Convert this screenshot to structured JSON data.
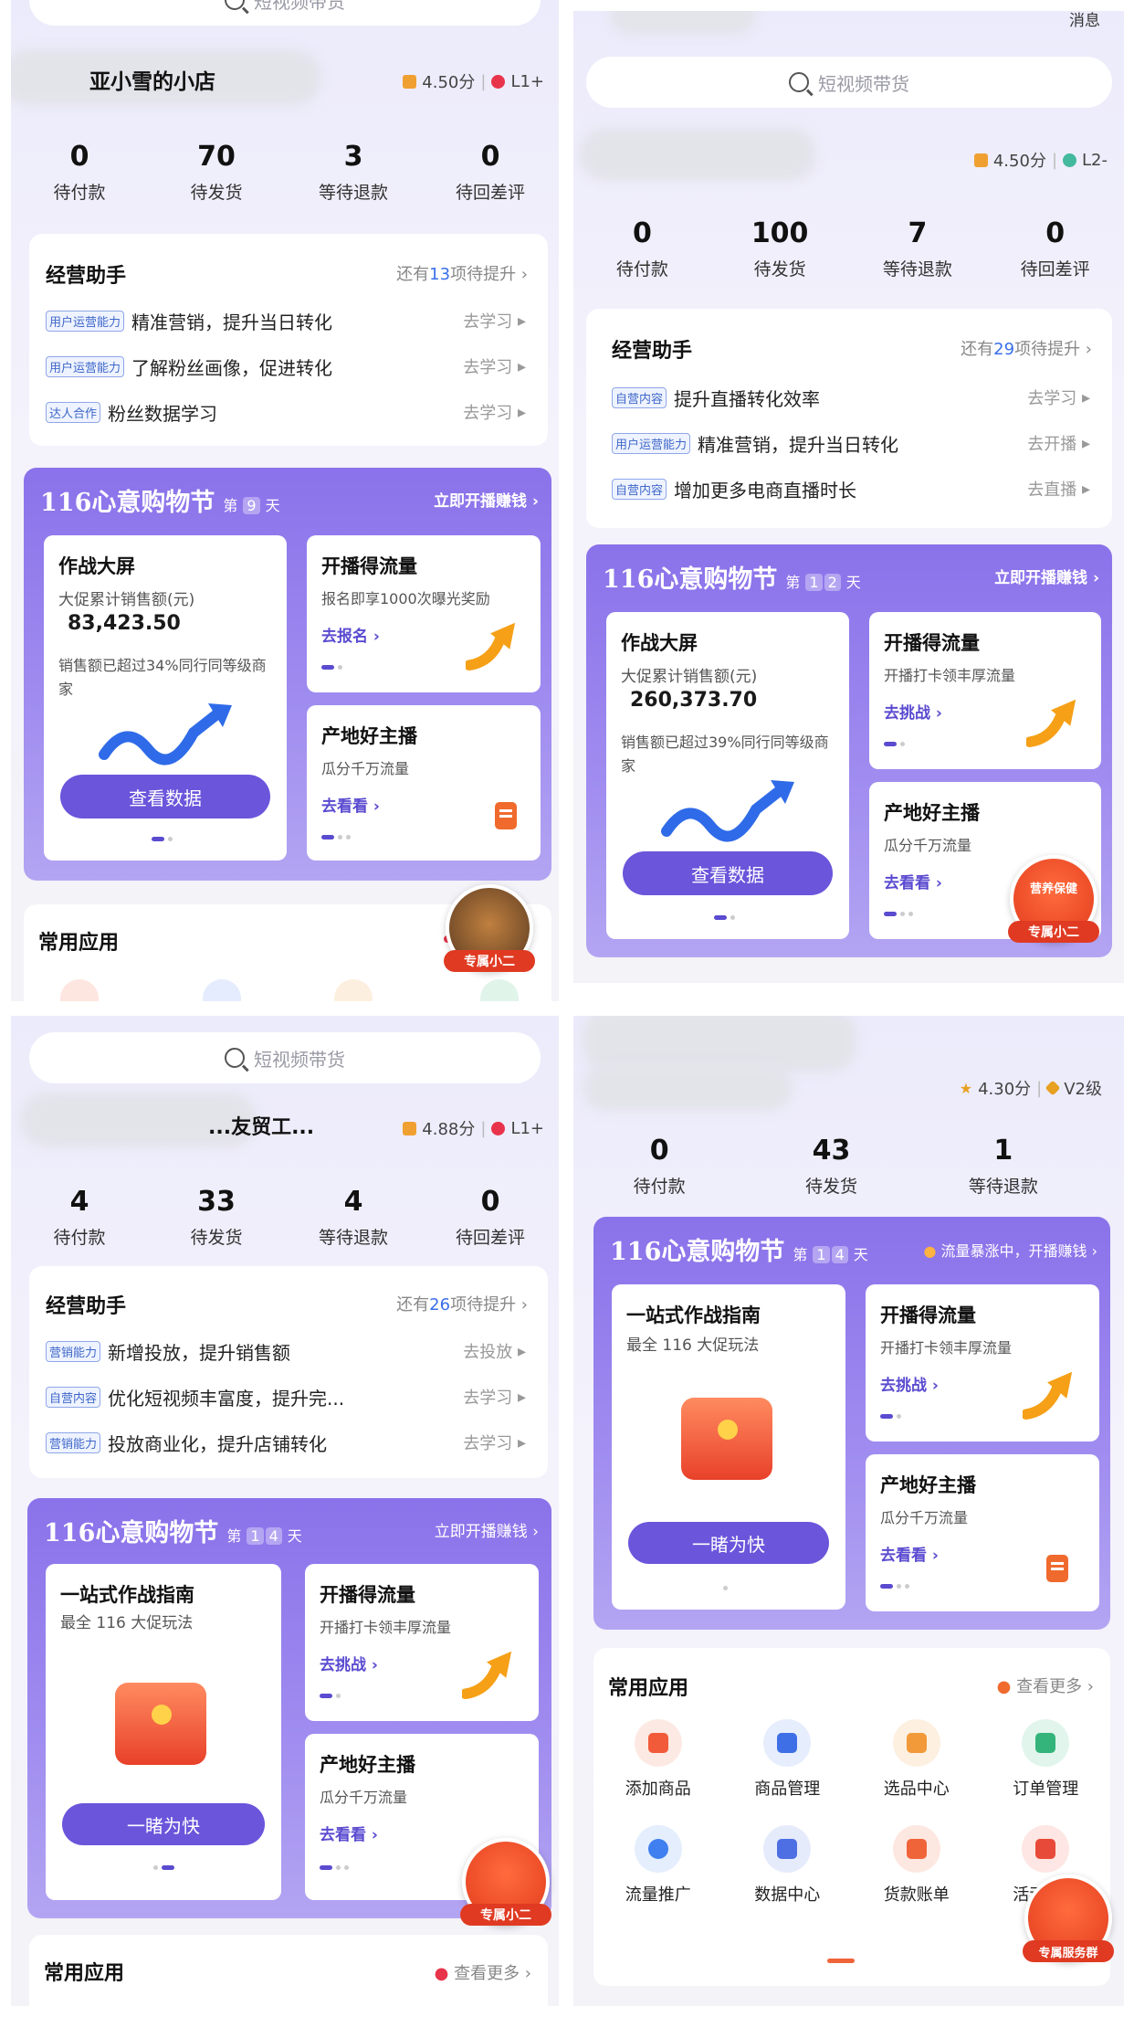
{
  "panel1": {
    "search": "短视频带货",
    "shop_name": "亚小雪的小店",
    "score": "4.50分",
    "level": "L1+",
    "stats": [
      {
        "n": "0",
        "l": "待付款"
      },
      {
        "n": "70",
        "l": "待发货"
      },
      {
        "n": "3",
        "l": "等待退款"
      },
      {
        "n": "0",
        "l": "待回差评"
      }
    ],
    "assistant": {
      "title": "经营助手",
      "more_pre": "还有",
      "more_num": "13",
      "more_post": "项待提升",
      "rows": [
        {
          "tag": "用户运营能力",
          "text": "精准营销，提升当日转化",
          "act": "去学习"
        },
        {
          "tag": "用户运营能力",
          "text": "了解粉丝画像，促进转化",
          "act": "去学习"
        },
        {
          "tag": "达人合作",
          "text": "粉丝数据学习",
          "act": "去学习"
        }
      ]
    },
    "promo": {
      "title": "116心意购物节",
      "day_pre": "第",
      "days": [
        "9"
      ],
      "day_post": "天",
      "cta": "立即开播赚钱",
      "left": {
        "title": "作战大屏",
        "sub": "大促累计销售额(元)",
        "value": "83,423.50",
        "note": "销售额已超过34%同行同等级商家",
        "btn": "查看数据"
      },
      "tr": {
        "title": "开播得流量",
        "desc": "报名即享1000次曝光奖励",
        "link": "去报名"
      },
      "br": {
        "title": "产地好主播",
        "desc": "瓜分千万流量",
        "link": "去看看"
      }
    },
    "apps_title": "常用应用",
    "badge": "专属小二"
  },
  "panel2": {
    "header_right": "消息",
    "search": "短视频带货",
    "score": "4.50分",
    "level": "L2-",
    "stats": [
      {
        "n": "0",
        "l": "待付款"
      },
      {
        "n": "100",
        "l": "待发货"
      },
      {
        "n": "7",
        "l": "等待退款"
      },
      {
        "n": "0",
        "l": "待回差评"
      }
    ],
    "assistant": {
      "title": "经营助手",
      "more_pre": "还有",
      "more_num": "29",
      "more_post": "项待提升",
      "rows": [
        {
          "tag": "自营内容",
          "text": "提升直播转化效率",
          "act": "去学习"
        },
        {
          "tag": "用户运营能力",
          "text": "精准营销，提升当日转化",
          "act": "去开播"
        },
        {
          "tag": "自营内容",
          "text": "增加更多电商直播时长",
          "act": "去直播"
        }
      ]
    },
    "promo": {
      "title": "116心意购物节",
      "day_pre": "第",
      "days": [
        "1",
        "2"
      ],
      "day_post": "天",
      "cta": "立即开播赚钱",
      "left": {
        "title": "作战大屏",
        "sub": "大促累计销售额(元)",
        "value": "260,373.70",
        "note": "销售额已超过39%同行同等级商家",
        "btn": "查看数据"
      },
      "tr": {
        "title": "开播得流量",
        "desc": "开播打卡领丰厚流量",
        "link": "去挑战"
      },
      "br": {
        "title": "产地好主播",
        "desc": "瓜分千万流量",
        "link": "去看看"
      }
    },
    "badge": "专属小二",
    "badge_top": "营养保健"
  },
  "panel3": {
    "search": "短视频带货",
    "shop_name": "...友贸工...",
    "score": "4.88分",
    "level": "L1+",
    "stats": [
      {
        "n": "4",
        "l": "待付款"
      },
      {
        "n": "33",
        "l": "待发货"
      },
      {
        "n": "4",
        "l": "等待退款"
      },
      {
        "n": "0",
        "l": "待回差评"
      }
    ],
    "assistant": {
      "title": "经营助手",
      "more_pre": "还有",
      "more_num": "26",
      "more_post": "项待提升",
      "rows": [
        {
          "tag": "营销能力",
          "text": "新增投放，提升销售额",
          "act": "去投放"
        },
        {
          "tag": "自营内容",
          "text": "优化短视频丰富度，提升完...",
          "act": "去学习"
        },
        {
          "tag": "营销能力",
          "text": "投放商业化，提升店铺转化",
          "act": "去学习"
        }
      ]
    },
    "promo": {
      "title": "116心意购物节",
      "day_pre": "第",
      "days": [
        "1",
        "4"
      ],
      "day_post": "天",
      "cta": "立即开播赚钱",
      "left": {
        "title": "一站式作战指南",
        "sub": "最全 116 大促玩法",
        "btn": "一睹为快"
      },
      "tr": {
        "title": "开播得流量",
        "desc": "开播打卡领丰厚流量",
        "link": "去挑战"
      },
      "br": {
        "title": "产地好主播",
        "desc": "瓜分千万流量",
        "link": "去看看"
      }
    },
    "apps_title": "常用应用",
    "apps_more": "查看更多",
    "badge": "专属小二"
  },
  "panel4": {
    "score": "4.30分",
    "level": "V2级",
    "stats": [
      {
        "n": "0",
        "l": "待付款"
      },
      {
        "n": "43",
        "l": "待发货"
      },
      {
        "n": "1",
        "l": "等待退款"
      }
    ],
    "promo": {
      "title": "116心意购物节",
      "day_pre": "第",
      "days": [
        "1",
        "4"
      ],
      "day_post": "天",
      "notice": "流量暴涨中，开播赚钱",
      "left": {
        "title": "一站式作战指南",
        "sub": "最全 116 大促玩法",
        "btn": "一睹为快"
      },
      "tr": {
        "title": "开播得流量",
        "desc": "开播打卡领丰厚流量",
        "link": "去挑战"
      },
      "br": {
        "title": "产地好主播",
        "desc": "瓜分千万流量",
        "link": "去看看"
      }
    },
    "apps_title": "常用应用",
    "apps_more": "查看更多",
    "apps": [
      {
        "label": "添加商品",
        "icon": "add-product-icon",
        "color": "#f25b3a",
        "bg": "#fde9e3"
      },
      {
        "label": "商品管理",
        "icon": "bag-icon",
        "color": "#3f6fe6",
        "bg": "#e6edfc"
      },
      {
        "label": "选品中心",
        "icon": "cart-icon",
        "color": "#f29a3a",
        "bg": "#fdf0e1"
      },
      {
        "label": "订单管理",
        "icon": "order-icon",
        "color": "#34b37a",
        "bg": "#e1f5ec"
      },
      {
        "label": "流量推广",
        "icon": "traffic-icon",
        "color": "#3f7ff0",
        "bg": "#e4eefd"
      },
      {
        "label": "数据中心",
        "icon": "chart-icon",
        "color": "#4d6fe3",
        "bg": "#e6ebfc"
      },
      {
        "label": "货款账单",
        "icon": "bill-icon",
        "color": "#f0643a",
        "bg": "#fde8e1"
      },
      {
        "label": "活动报名",
        "icon": "activity-icon",
        "color": "#e84a3a",
        "bg": "#fde6e3"
      }
    ],
    "badge": "专属服务群"
  }
}
